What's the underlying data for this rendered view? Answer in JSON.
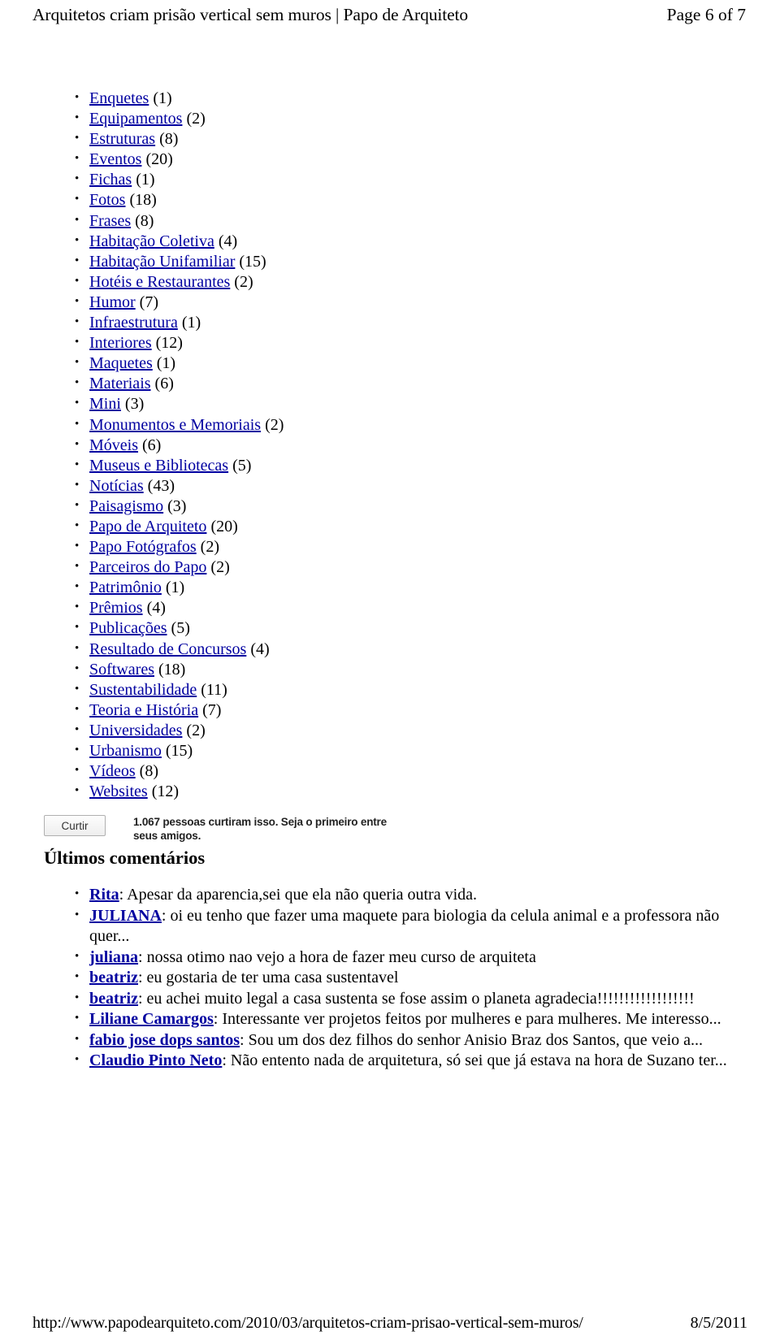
{
  "header": {
    "title": "Arquitetos criam prisão vertical sem muros | Papo de Arquiteto",
    "page_indicator": "Page 6 of 7"
  },
  "categories": [
    {
      "label": "Enquetes",
      "count": "(1)"
    },
    {
      "label": "Equipamentos",
      "count": "(2)"
    },
    {
      "label": "Estruturas",
      "count": "(8)"
    },
    {
      "label": "Eventos",
      "count": "(20)"
    },
    {
      "label": "Fichas",
      "count": "(1)"
    },
    {
      "label": "Fotos",
      "count": "(18)"
    },
    {
      "label": "Frases",
      "count": "(8)"
    },
    {
      "label": "Habitação Coletiva",
      "count": "(4)"
    },
    {
      "label": "Habitação Unifamiliar",
      "count": "(15)"
    },
    {
      "label": "Hotéis e Restaurantes",
      "count": "(2)"
    },
    {
      "label": "Humor",
      "count": "(7)"
    },
    {
      "label": "Infraestrutura",
      "count": "(1)"
    },
    {
      "label": "Interiores",
      "count": "(12)"
    },
    {
      "label": "Maquetes",
      "count": "(1)"
    },
    {
      "label": "Materiais",
      "count": "(6)"
    },
    {
      "label": "Mini",
      "count": "(3)"
    },
    {
      "label": "Monumentos e Memoriais",
      "count": "(2)"
    },
    {
      "label": "Móveis",
      "count": "(6)"
    },
    {
      "label": "Museus e Bibliotecas",
      "count": "(5)"
    },
    {
      "label": "Notícias",
      "count": "(43)"
    },
    {
      "label": "Paisagismo",
      "count": "(3)"
    },
    {
      "label": "Papo de Arquiteto",
      "count": "(20)"
    },
    {
      "label": "Papo Fotógrafos",
      "count": "(2)"
    },
    {
      "label": "Parceiros do Papo",
      "count": "(2)"
    },
    {
      "label": "Patrimônio",
      "count": "(1)"
    },
    {
      "label": "Prêmios",
      "count": "(4)"
    },
    {
      "label": "Publicações",
      "count": "(5)"
    },
    {
      "label": "Resultado de Concursos",
      "count": "(4)"
    },
    {
      "label": "Softwares",
      "count": "(18)"
    },
    {
      "label": "Sustentabilidade",
      "count": "(11)"
    },
    {
      "label": "Teoria e História",
      "count": "(7)"
    },
    {
      "label": "Universidades",
      "count": "(2)"
    },
    {
      "label": "Urbanismo",
      "count": "(15)"
    },
    {
      "label": "Vídeos",
      "count": "(8)"
    },
    {
      "label": "Websites",
      "count": "(12)"
    }
  ],
  "like_widget": {
    "button_label": "Curtir",
    "text": "1.067 pessoas curtiram isso. Seja o primeiro entre seus amigos."
  },
  "comments": {
    "title": "Últimos comentários",
    "items": [
      {
        "author": "Rita",
        "text": ": Apesar da aparencia,sei que ela não queria outra vida."
      },
      {
        "author": "JULIANA",
        "text": ": oi eu tenho que fazer uma maquete para biologia da celula animal e a professora não quer..."
      },
      {
        "author": "juliana",
        "text": ": nossa otimo nao vejo a hora de fazer meu curso de arquiteta"
      },
      {
        "author": "beatriz",
        "text": ": eu gostaria de ter uma casa sustentavel"
      },
      {
        "author": "beatriz",
        "text": ": eu achei muito legal a casa sustenta se fose assim o planeta agradecia!!!!!!!!!!!!!!!!!!"
      },
      {
        "author": "Liliane Camargos",
        "text": ": Interessante ver projetos feitos por mulheres e para mulheres. Me interesso..."
      },
      {
        "author": "fabio jose dops santos",
        "text": ": Sou um dos dez filhos do senhor Anisio Braz dos Santos, que veio a..."
      },
      {
        "author": "Claudio Pinto Neto",
        "text": ": Não entento nada de arquitetura, só sei que já estava na hora de Suzano ter..."
      }
    ]
  },
  "footer": {
    "url": "http://www.papodearquiteto.com/2010/03/arquitetos-criam-prisao-vertical-sem-muros/",
    "date": "8/5/2011"
  }
}
